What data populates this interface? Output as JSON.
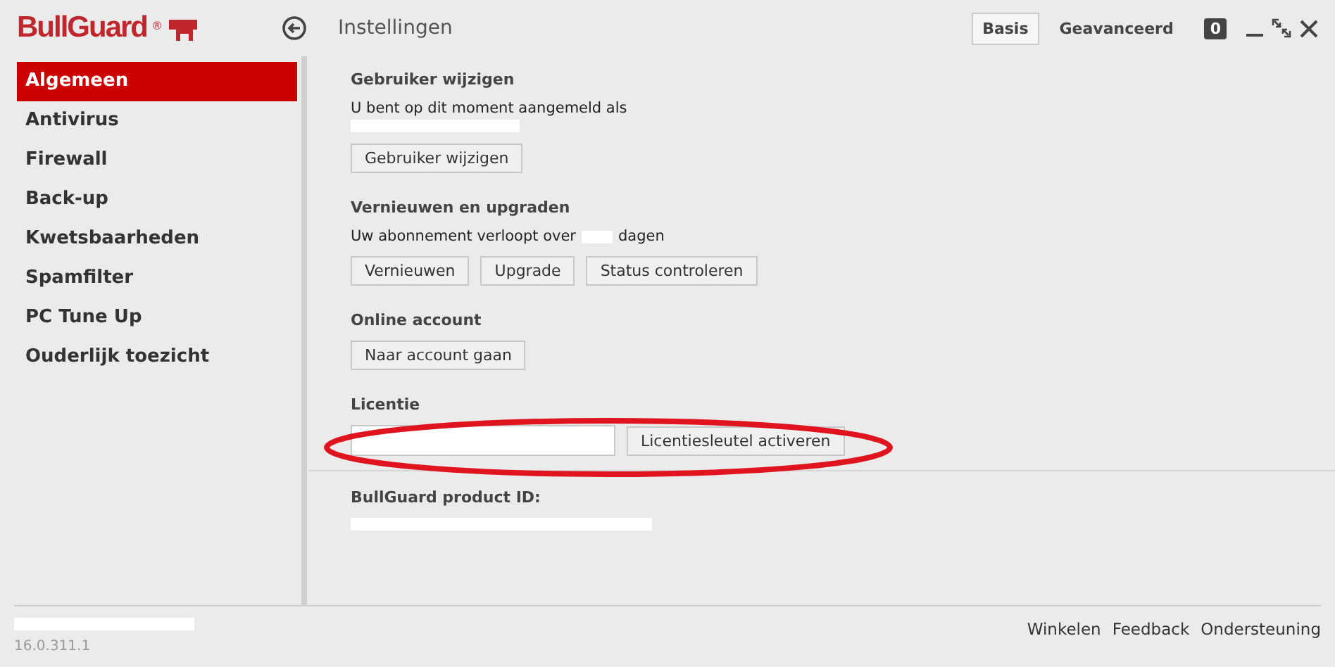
{
  "app": {
    "logo": "BullGuard",
    "logo_mark": "®"
  },
  "header": {
    "title": "Instellingen",
    "modes": [
      {
        "label": "Basis",
        "selected": true
      },
      {
        "label": "Geavanceerd",
        "selected": false
      }
    ],
    "notifications": "0"
  },
  "sidebar": {
    "items": [
      {
        "label": "Algemeen",
        "selected": true
      },
      {
        "label": "Antivirus",
        "selected": false
      },
      {
        "label": "Firewall",
        "selected": false
      },
      {
        "label": "Back-up",
        "selected": false
      },
      {
        "label": "Kwetsbaarheden",
        "selected": false
      },
      {
        "label": "Spamfilter",
        "selected": false
      },
      {
        "label": "PC Tune Up",
        "selected": false
      },
      {
        "label": "Ouderlijk toezicht",
        "selected": false
      }
    ]
  },
  "sections": [
    {
      "title": "Gebruiker wijzigen",
      "text": "U bent op dit moment aangemeld als",
      "buttons": [
        "Gebruiker wijzigen"
      ]
    },
    {
      "title": "Vernieuwen en upgraden",
      "text_before": "Uw abonnement verloopt over",
      "text_after": "dagen",
      "buttons": [
        "Vernieuwen",
        "Upgrade",
        "Status controleren"
      ]
    },
    {
      "title": "Online account",
      "buttons": [
        "Naar account gaan"
      ]
    },
    {
      "title": "Licentie",
      "buttons": [
        "Licentiesleutel activeren"
      ]
    },
    {
      "title": "BullGuard product ID:"
    }
  ],
  "footer": {
    "version": "16.0.311.1",
    "links": [
      "Winkelen",
      "Feedback",
      "Ondersteuning"
    ]
  }
}
